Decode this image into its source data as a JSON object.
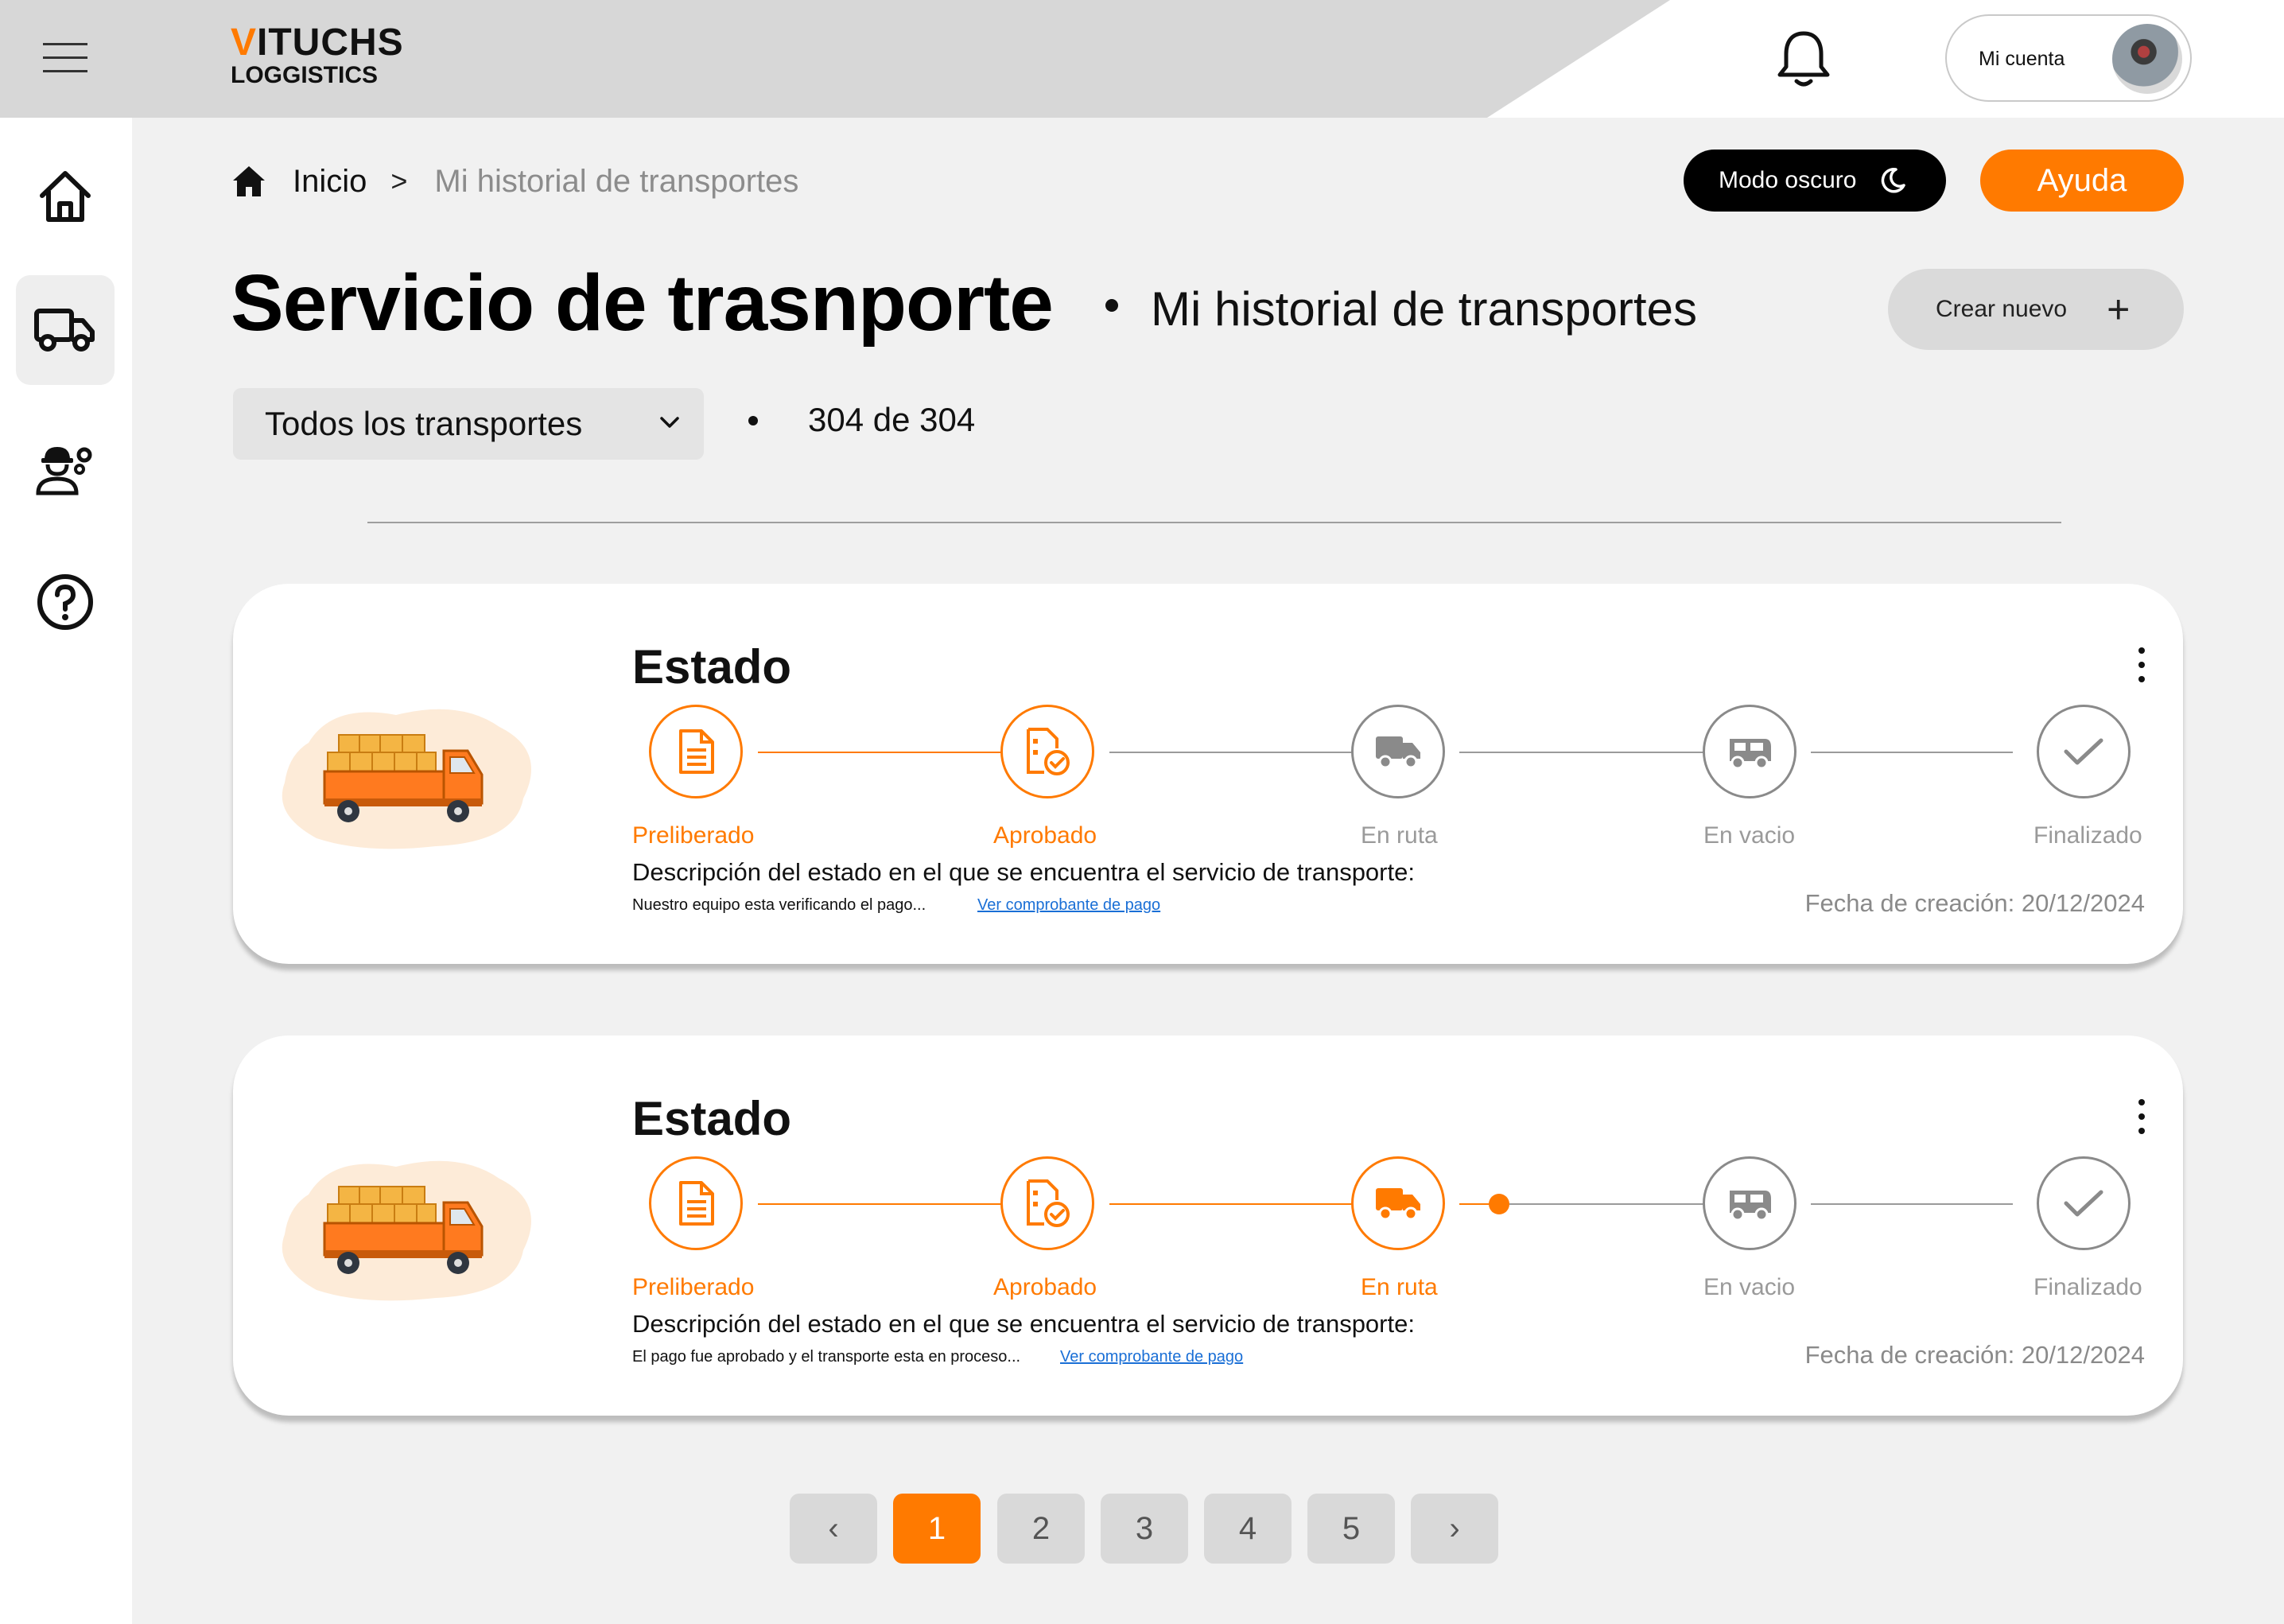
{
  "brand": {
    "name_first_letter": "V",
    "name_rest": "ITUCHS",
    "tagline": "LOGGISTICS",
    "accent_color": "#ff7a00"
  },
  "header": {
    "account_label": "Mi cuenta"
  },
  "sidebar": {
    "items": [
      {
        "name": "home",
        "icon": "home-icon"
      },
      {
        "name": "transport",
        "icon": "truck-icon",
        "active": true
      },
      {
        "name": "operators",
        "icon": "worker-gear-icon"
      },
      {
        "name": "help",
        "icon": "help-circle-icon"
      }
    ]
  },
  "breadcrumb": {
    "home": "Inicio",
    "separator": ">",
    "current": "Mi historial de transportes"
  },
  "actions": {
    "dark_mode_label": "Modo oscuro",
    "help_label": "Ayuda",
    "create_label": "Crear nuevo",
    "create_icon": "+"
  },
  "page": {
    "title": "Servicio de trasnporte",
    "subtitle": "Mi historial de transportes"
  },
  "filter": {
    "selected": "Todos los transportes",
    "count": "304 de 304"
  },
  "cards": [
    {
      "title": "Estado",
      "steps": [
        {
          "label": "Preliberado",
          "icon": "document-icon",
          "status": "done"
        },
        {
          "label": "Aprobado",
          "icon": "document-check-icon",
          "status": "done"
        },
        {
          "label": "En ruta",
          "icon": "truck-icon",
          "status": "pending"
        },
        {
          "label": "En vacio",
          "icon": "van-icon",
          "status": "pending"
        },
        {
          "label": "Finalizado",
          "icon": "check-icon",
          "status": "pending"
        }
      ],
      "description": "Descripción del estado en el que se encuentra el servicio de transporte:",
      "note": "Nuestro equipo esta verificando el pago...",
      "link": "Ver comprobante de pago",
      "created": "Fecha de creación: 20/12/2024"
    },
    {
      "title": "Estado",
      "steps": [
        {
          "label": "Preliberado",
          "icon": "document-icon",
          "status": "done"
        },
        {
          "label": "Aprobado",
          "icon": "document-check-icon",
          "status": "done"
        },
        {
          "label": "En ruta",
          "icon": "truck-icon",
          "status": "done"
        },
        {
          "label": "En vacio",
          "icon": "van-icon",
          "status": "pending"
        },
        {
          "label": "Finalizado",
          "icon": "check-icon",
          "status": "pending"
        }
      ],
      "description": "Descripción del estado en el que se encuentra el servicio de transporte:",
      "note": "El pago fue aprobado y el transporte esta en proceso...",
      "link": "Ver comprobante de pago",
      "created": "Fecha de creación: 20/12/2024"
    }
  ],
  "pagination": {
    "prev": "‹",
    "pages": [
      "1",
      "2",
      "3",
      "4",
      "5"
    ],
    "current": "1",
    "next": "›"
  }
}
